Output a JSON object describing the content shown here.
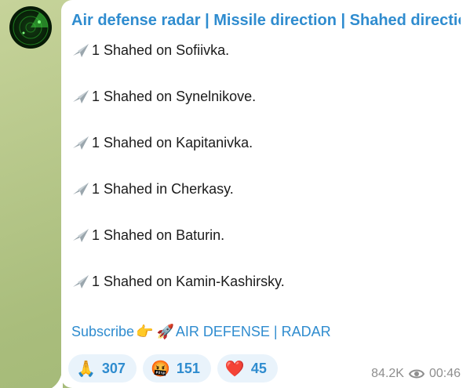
{
  "channel": {
    "title": "Air defense radar | Missile direction | Shahed direction |"
  },
  "messages": [
    {
      "text": "1 Shahed on Sofiivka."
    },
    {
      "text": "1 Shahed on Synelnikove."
    },
    {
      "text": "1 Shahed on Kapitanivka."
    },
    {
      "text": "1 Shahed in Cherkasy."
    },
    {
      "text": "1 Shahed on Baturin."
    },
    {
      "text": "1 Shahed on Kamin-Kashirsky."
    }
  ],
  "subscribe": {
    "prefix": "Subscribe",
    "pointer_emoji": "👉",
    "rocket_emoji": "🚀",
    "link": "AIR DEFENSE | RADAR"
  },
  "reactions": [
    {
      "emoji": "🙏",
      "count": "307"
    },
    {
      "emoji": "🤬",
      "count": "151"
    },
    {
      "emoji": "❤️",
      "count": "45"
    }
  ],
  "meta": {
    "views": "84.2K",
    "time": "00:46"
  },
  "colors": {
    "accent": "#2f8ccf",
    "background": "#b9c98d",
    "bubble": "#ffffff"
  }
}
